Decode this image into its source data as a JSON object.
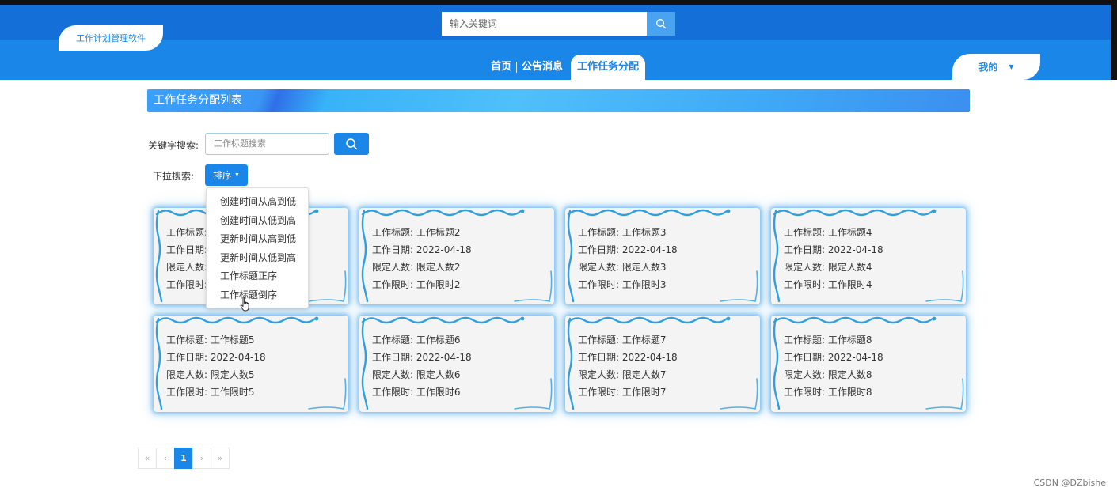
{
  "header": {
    "logo_text": "工作计划管理软件",
    "search_placeholder": "输入关键词",
    "nav": [
      {
        "label": "首页"
      },
      {
        "label": "公告消息"
      },
      {
        "label": "工作任务分配"
      }
    ],
    "active_nav": "工作任务分配",
    "user_menu_label": "我的"
  },
  "page": {
    "title": "工作任务分配列表"
  },
  "filters": {
    "keyword_label": "关键字搜索:",
    "keyword_placeholder": "工作标题搜索",
    "dropdown_label": "下拉搜索:",
    "sort_button_label": "排序",
    "sort_options": [
      "创建时间从高到低",
      "创建时间从低到高",
      "更新时间从高到低",
      "更新时间从低到高",
      "工作标题正序",
      "工作标题倒序"
    ]
  },
  "cards": [
    {
      "title_label": "工作标题:",
      "title": "",
      "date_label": "工作日期:",
      "date": "",
      "limit_label": "限定人数:",
      "limit": "",
      "deadline_label": "工作限时:",
      "deadline": ""
    },
    {
      "title_label": "工作标题:",
      "title": "工作标题2",
      "date_label": "工作日期:",
      "date": "2022-04-18",
      "limit_label": "限定人数:",
      "limit": "限定人数2",
      "deadline_label": "工作限时:",
      "deadline": "工作限时2"
    },
    {
      "title_label": "工作标题:",
      "title": "工作标题3",
      "date_label": "工作日期:",
      "date": "2022-04-18",
      "limit_label": "限定人数:",
      "limit": "限定人数3",
      "deadline_label": "工作限时:",
      "deadline": "工作限时3"
    },
    {
      "title_label": "工作标题:",
      "title": "工作标题4",
      "date_label": "工作日期:",
      "date": "2022-04-18",
      "limit_label": "限定人数:",
      "limit": "限定人数4",
      "deadline_label": "工作限时:",
      "deadline": "工作限时4"
    },
    {
      "title_label": "工作标题:",
      "title": "工作标题5",
      "date_label": "工作日期:",
      "date": "2022-04-18",
      "limit_label": "限定人数:",
      "limit": "限定人数5",
      "deadline_label": "工作限时:",
      "deadline": "工作限时5"
    },
    {
      "title_label": "工作标题:",
      "title": "工作标题6",
      "date_label": "工作日期:",
      "date": "2022-04-18",
      "limit_label": "限定人数:",
      "limit": "限定人数6",
      "deadline_label": "工作限时:",
      "deadline": "工作限时6"
    },
    {
      "title_label": "工作标题:",
      "title": "工作标题7",
      "date_label": "工作日期:",
      "date": "2022-04-18",
      "limit_label": "限定人数:",
      "limit": "限定人数7",
      "deadline_label": "工作限时:",
      "deadline": "工作限时7"
    },
    {
      "title_label": "工作标题:",
      "title": "工作标题8",
      "date_label": "工作日期:",
      "date": "2022-04-18",
      "limit_label": "限定人数:",
      "limit": "限定人数8",
      "deadline_label": "工作限时:",
      "deadline": "工作限时8"
    }
  ],
  "pagination": {
    "first": "«",
    "prev": "‹",
    "current": "1",
    "next": "›",
    "last": "»"
  },
  "watermark": "CSDN @DZbishe",
  "colors": {
    "primary": "#1a86e8",
    "header_top": "#1470d8",
    "card_glow": "#2896e6"
  }
}
